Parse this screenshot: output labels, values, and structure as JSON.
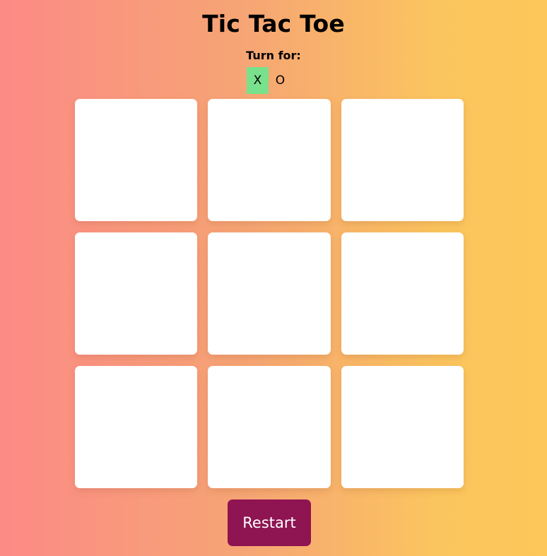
{
  "game": {
    "title": "Tic Tac Toe",
    "turn_label": "Turn for:",
    "players": [
      {
        "symbol": "X",
        "active": true
      },
      {
        "symbol": "O",
        "active": false
      }
    ]
  },
  "board": {
    "cells": [
      "",
      "",
      "",
      "",
      "",
      "",
      "",
      "",
      ""
    ]
  },
  "controls": {
    "restart_label": "Restart"
  },
  "colors": {
    "background_gradient_start": "#fc8a86",
    "background_gradient_end": "#fdc75a",
    "active_turn": "#79e08c",
    "restart_button": "#8e1452",
    "cell": "#ffffff"
  }
}
